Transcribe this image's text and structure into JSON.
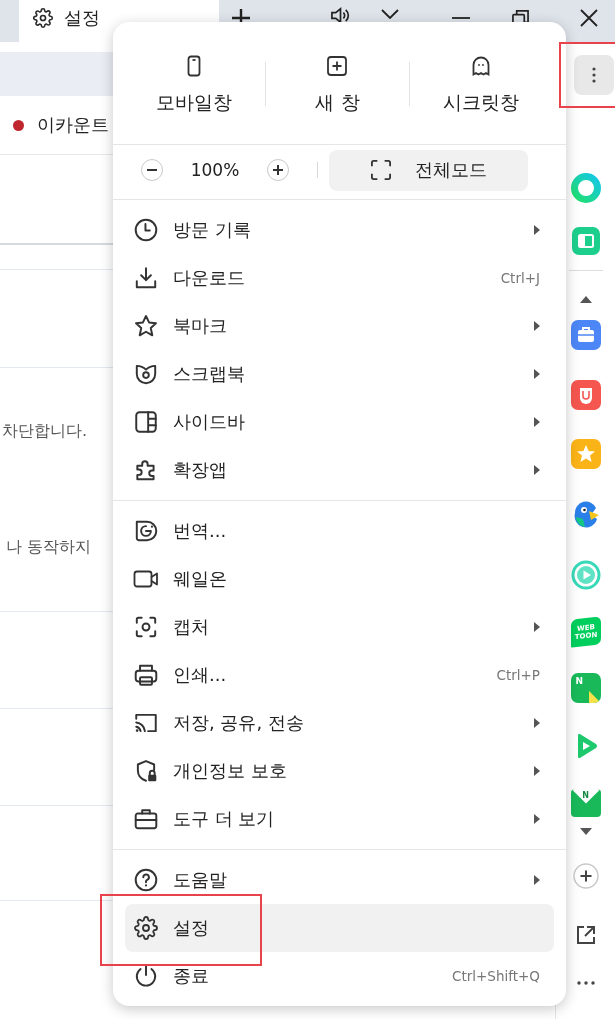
{
  "title_bar": {
    "tabs": [
      {
        "label": "설정",
        "selected": true
      }
    ]
  },
  "page": {
    "account": {
      "name": "이카운트"
    },
    "fragments": [
      "차단합니다.",
      "나 동작하지"
    ]
  },
  "menu": {
    "quick_actions": [
      "모바일창",
      "새 창",
      "시크릿창"
    ],
    "zoom": {
      "reading": "100%"
    },
    "fullscreen": "전체모드",
    "sections": [
      {
        "items": [
          {
            "label": "방문 기록",
            "submenu": true,
            "selected": false,
            "highlighted": false
          },
          {
            "label": "다운로드",
            "shortcut": "Ctrl+J",
            "submenu": false,
            "selected": false,
            "highlighted": false
          },
          {
            "label": "북마크",
            "submenu": true,
            "selected": false,
            "highlighted": false
          },
          {
            "label": "스크랩북",
            "submenu": true,
            "selected": false,
            "highlighted": false
          },
          {
            "label": "사이드바",
            "submenu": true,
            "selected": false,
            "highlighted": false
          },
          {
            "label": "확장앱",
            "submenu": true,
            "selected": false,
            "highlighted": false
          }
        ]
      },
      {
        "items": [
          {
            "label": "번역...",
            "submenu": false,
            "selected": false,
            "highlighted": false
          },
          {
            "label": "웨일온",
            "submenu": false,
            "selected": false,
            "highlighted": false
          },
          {
            "label": "캡처",
            "submenu": true,
            "selected": false,
            "highlighted": false
          },
          {
            "label": "인쇄...",
            "shortcut": "Ctrl+P",
            "submenu": false,
            "selected": false,
            "highlighted": false
          },
          {
            "label": "저장, 공유, 전송",
            "submenu": true,
            "selected": false,
            "highlighted": false
          },
          {
            "label": "개인정보 보호",
            "submenu": true,
            "selected": false,
            "highlighted": false
          },
          {
            "label": "도구 더 보기",
            "submenu": true,
            "selected": false,
            "highlighted": false
          }
        ]
      },
      {
        "items": [
          {
            "label": "도움말",
            "submenu": true,
            "selected": false,
            "highlighted": false
          },
          {
            "label": "설정",
            "submenu": false,
            "selected": true,
            "highlighted": true
          },
          {
            "label": "종료",
            "shortcut": "Ctrl+Shift+Q",
            "submenu": false,
            "selected": false,
            "highlighted": false
          }
        ]
      }
    ]
  },
  "sidebar": {
    "more_button": {
      "highlighted": true
    },
    "badged_apps": [
      {
        "lines": [
          "WEB",
          "TOON"
        ]
      },
      {
        "lines": [
          "N"
        ]
      },
      {
        "lines": [
          "N"
        ]
      }
    ]
  }
}
